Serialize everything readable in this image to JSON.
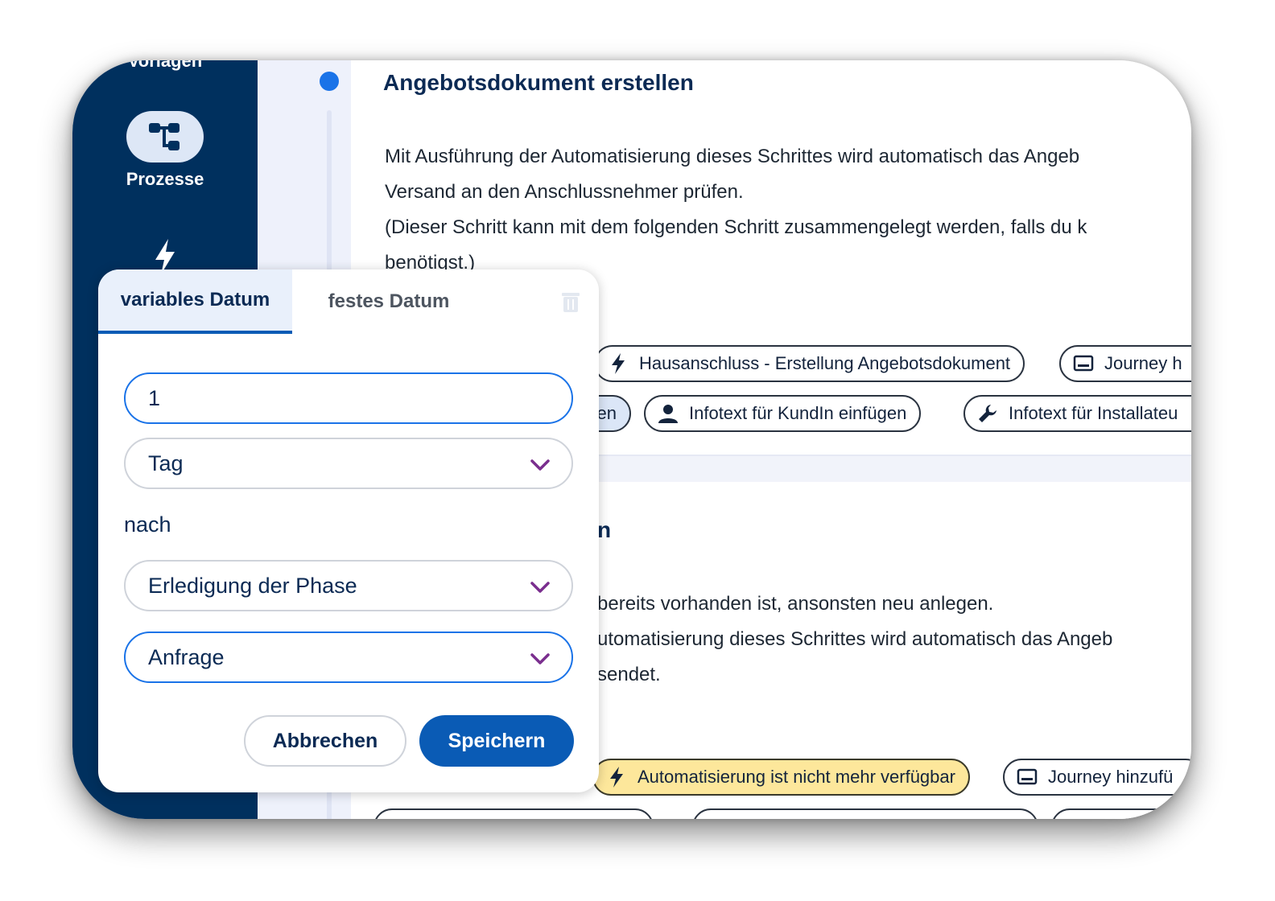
{
  "sidebar": {
    "cut_label": "Vorlagen",
    "items": [
      {
        "label": "Prozesse",
        "icon": "process-tree-icon"
      },
      {
        "label": "",
        "icon": "lightning-icon"
      }
    ]
  },
  "step1": {
    "title": "Angebotsdokument erstellen",
    "description": [
      "Mit Ausführung der Automatisierung dieses Schrittes wird automatisch das Angeb",
      "Versand an den Anschlussnehmer prüfen.",
      "(Dieser Schritt kann mit dem folgenden Schritt zusammengelegt werden, falls du k",
      "benötigst.)"
    ],
    "chips_row1": [
      {
        "label": "Hausanschluss - Erstellung Angebotsdokument",
        "icon": "lightning-icon"
      },
      {
        "label": "Journey h",
        "icon": "monitor-icon"
      }
    ],
    "chips_row2": [
      {
        "label": "en",
        "icon": ""
      },
      {
        "label": "Infotext für KundIn einfügen",
        "icon": "person-icon"
      },
      {
        "label": "Infotext für Installateu",
        "icon": "wrench-icon"
      }
    ]
  },
  "step2": {
    "title_fragment": "n",
    "description": [
      "bereits vorhanden ist, ansonsten neu anlegen.",
      "utomatisierung dieses Schrittes wird automatisch das Angeb",
      "sendet."
    ],
    "chips": [
      {
        "label": "Automatisierung ist nicht mehr verfügbar",
        "icon": "lightning-icon"
      },
      {
        "label": "Journey hinzufü",
        "icon": "monitor-icon"
      }
    ]
  },
  "popup": {
    "tabs": [
      "variables Datum",
      "festes Datum"
    ],
    "amount_value": "1",
    "unit_value": "Tag",
    "nach_label": "nach",
    "reference_value": "Erledigung der Phase",
    "phase_value": "Anfrage",
    "cancel_label": "Abbrechen",
    "save_label": "Speichern"
  },
  "colors": {
    "sidebar": "#00305e",
    "primary": "#0a5bb5",
    "focus": "#1a73e8",
    "chevron": "#7a2e8e",
    "warning_chip": "#fde79b"
  }
}
